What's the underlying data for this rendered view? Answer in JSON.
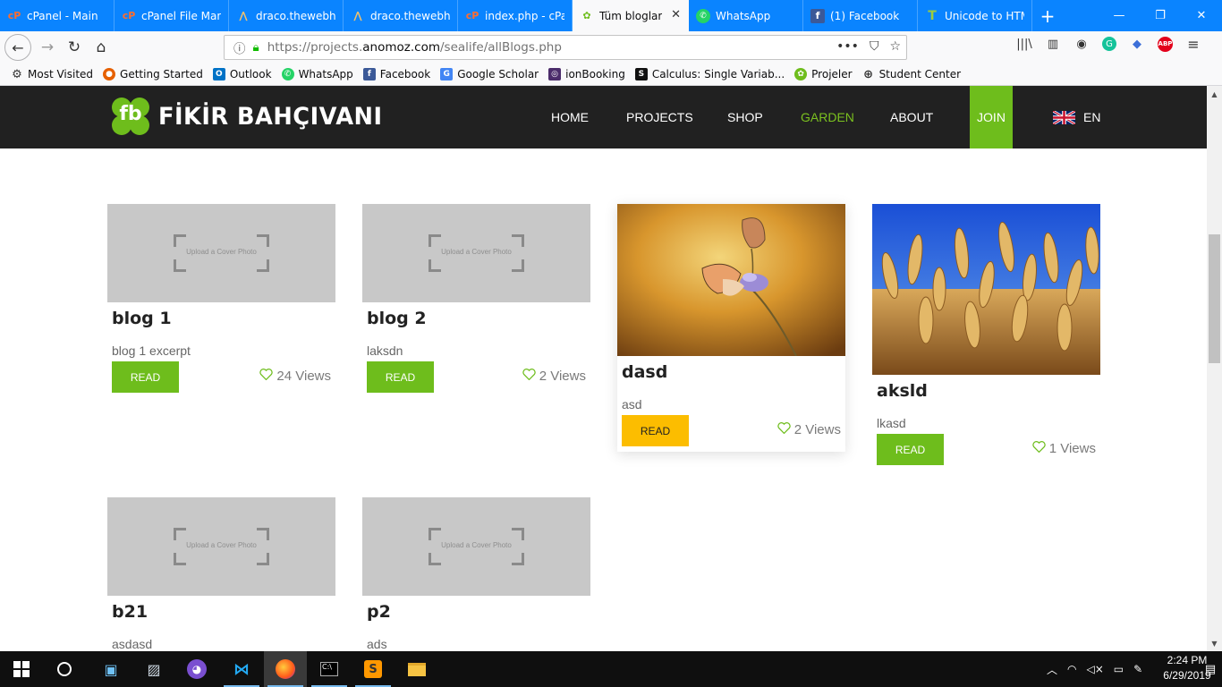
{
  "browser": {
    "tabs": [
      {
        "title": "cPanel - Main",
        "icon": "cpanel-icon"
      },
      {
        "title": "cPanel File Mana",
        "icon": "cpanel-icon"
      },
      {
        "title": "draco.thewebho",
        "icon": "draco-icon"
      },
      {
        "title": "draco.thewebho",
        "icon": "draco-icon"
      },
      {
        "title": "index.php - cPa",
        "icon": "cpanel-icon"
      },
      {
        "title": "Tüm bloglar",
        "icon": "fb-site-icon",
        "active": true
      },
      {
        "title": "WhatsApp",
        "icon": "whatsapp-icon"
      },
      {
        "title": "(1) Facebook",
        "icon": "facebook-icon"
      },
      {
        "title": "Unicode to HTM",
        "icon": "unicode-icon"
      }
    ],
    "url_prefix": "https://projects.",
    "url_host": "anomoz.com",
    "url_path": "/sealife/allBlogs.php",
    "bookmarks": [
      {
        "label": "Most Visited",
        "icon": "gear-icon"
      },
      {
        "label": "Getting Started",
        "icon": "firefox-icon"
      },
      {
        "label": "Outlook",
        "icon": "outlook-icon"
      },
      {
        "label": "WhatsApp",
        "icon": "whatsapp-icon"
      },
      {
        "label": "Facebook",
        "icon": "facebook-icon"
      },
      {
        "label": "Google Scholar",
        "icon": "scholar-icon"
      },
      {
        "label": "ionBooking",
        "icon": "ion-icon"
      },
      {
        "label": "Calculus: Single Variab...",
        "icon": "coursera-icon"
      },
      {
        "label": "Projeler",
        "icon": "projeler-icon"
      },
      {
        "label": "Student Center",
        "icon": "globe-icon"
      }
    ]
  },
  "site": {
    "logo_mark": "fb",
    "logo_name": "FİKİR BAHÇIVANI",
    "nav": {
      "home": "HOME",
      "projects": "PROJECTS",
      "shop": "SHOP",
      "garden": "GARDEN",
      "about": "ABOUT",
      "join": "JOIN"
    },
    "language": "EN",
    "accent_color": "#6ebd1c",
    "header_color": "#212121"
  },
  "blogs": [
    {
      "title": "blog 1",
      "excerpt": "blog 1 excerpt",
      "views": "24 Views",
      "read_label": "READ",
      "cover": "placeholder",
      "placeholder_text": "Upload a Cover Photo"
    },
    {
      "title": "blog 2",
      "excerpt": "laksdn",
      "views": "2 Views",
      "read_label": "READ",
      "cover": "placeholder",
      "placeholder_text": "Upload a Cover Photo"
    },
    {
      "title": "dasd",
      "excerpt": "asd",
      "views": "2 Views",
      "read_label": "READ",
      "cover": "butterfly-photo",
      "hovered": true
    },
    {
      "title": "aksld",
      "excerpt": "lkasd",
      "views": "1 Views",
      "read_label": "READ",
      "cover": "wheat-photo"
    },
    {
      "title": "b21",
      "excerpt": "asdasd",
      "cover": "placeholder",
      "placeholder_text": "Upload a Cover Photo"
    },
    {
      "title": "p2",
      "excerpt": "ads",
      "cover": "placeholder",
      "placeholder_text": "Upload a Cover Photo"
    }
  ],
  "taskbar": {
    "time": "2:24 PM",
    "date": "6/29/2019"
  }
}
